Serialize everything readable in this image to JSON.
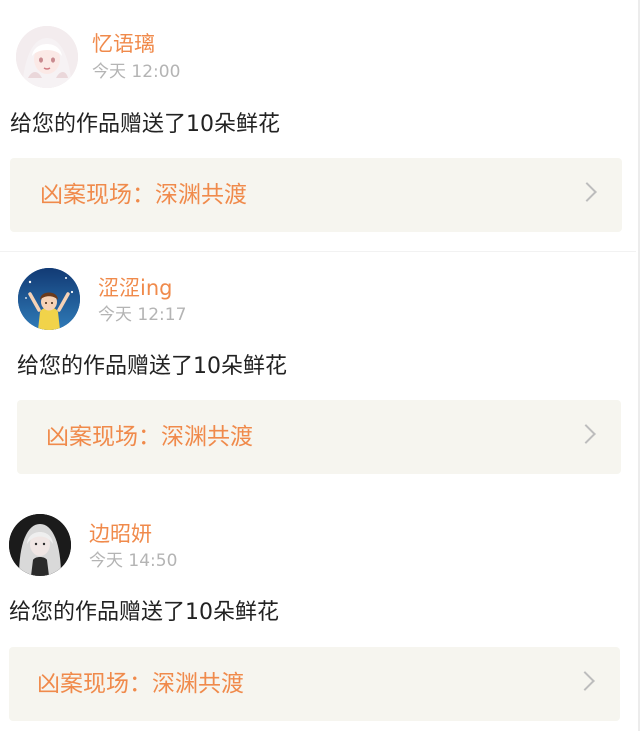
{
  "items": [
    {
      "username": "忆语璃",
      "time": "今天 12:00",
      "message": "给您的作品赠送了10朵鲜花",
      "card_title": "凶案现场：深渊共渡",
      "avatar_icon": "avatar-girl-white-hair-icon"
    },
    {
      "username": "涩涩ing",
      "time": "今天 12:17",
      "message": "给您的作品赠送了10朵鲜花",
      "card_title": "凶案现场：深渊共渡",
      "avatar_icon": "avatar-girl-blue-sky-icon"
    },
    {
      "username": "边昭妍",
      "time": "今天 14:50",
      "message": "给您的作品赠送了10朵鲜花",
      "card_title": "凶案现场：深渊共渡",
      "avatar_icon": "avatar-girl-dark-icon"
    }
  ],
  "colors": {
    "accent": "#f08a4b",
    "card_bg": "#f6f5ef",
    "time": "#b4b4b4",
    "text": "#222222"
  }
}
